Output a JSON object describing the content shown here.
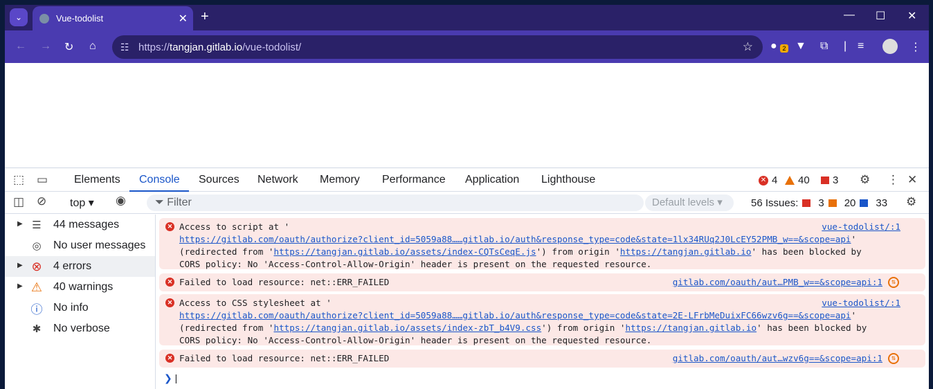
{
  "browser": {
    "tab_title": "Vue-todolist",
    "url_scheme": "https://",
    "url_host": "tangjan.gitlab.io",
    "url_path": "/vue-todolist/",
    "extension_badge": "2"
  },
  "devtools": {
    "tabs": [
      "Elements",
      "Console",
      "Sources",
      "Network",
      "Memory",
      "Performance",
      "Application",
      "Lighthouse"
    ],
    "active_tab": "Console",
    "counts": {
      "errors": "4",
      "warnings": "40",
      "issues": "3"
    },
    "context": "top",
    "filter_placeholder": "Filter",
    "levels": "Default levels",
    "issues_summary": {
      "label": "56 Issues:",
      "red": "3",
      "orange": "20",
      "blue": "33"
    }
  },
  "sidebar": {
    "items": [
      {
        "label": "44 messages",
        "icon": "list-icon"
      },
      {
        "label": "No user messages",
        "icon": "user-icon"
      },
      {
        "label": "4 errors",
        "icon": "error-icon"
      },
      {
        "label": "40 warnings",
        "icon": "warning-icon"
      },
      {
        "label": "No info",
        "icon": "info-icon"
      },
      {
        "label": "No verbose",
        "icon": "bug-icon"
      }
    ]
  },
  "console": {
    "messages": [
      {
        "l1": "Access to script at '",
        "url1": "https://gitlab.com/oauth/authorize?client_id=5059a88……gitlab.io/auth&response_type=code&state=1lx34RUq2J0LcEY52PMB_w==&scope=api",
        "l2_pre": "(redirected from '",
        "url2": "https://tangjan.gitlab.io/assets/index-CQTsCeqE.js",
        "l2_mid": "') from origin '",
        "url3": "https://tangjan.gitlab.io",
        "l2_post": "' has been blocked by",
        "l3": "CORS policy: No 'Access-Control-Allow-Origin' header is present on the requested resource.",
        "source": "vue-todolist/:1"
      },
      {
        "text": "Failed to load resource: net::ERR_FAILED",
        "source": "gitlab.com/oauth/aut…PMB_w==&scope=api:1"
      },
      {
        "l1": "Access to CSS stylesheet at '",
        "url1": "https://gitlab.com/oauth/authorize?client_id=5059a88……gitlab.io/auth&response_type=code&state=2E-LFrbMeDuixFC66wzv6g==&scope=api",
        "l2_pre": "(redirected from '",
        "url2": "https://tangjan.gitlab.io/assets/index-zbT_b4V9.css",
        "l2_mid": "') from origin '",
        "url3": "https://tangjan.gitlab.io",
        "l2_post": "' has been blocked by",
        "l3": "CORS policy: No 'Access-Control-Allow-Origin' header is present on the requested resource.",
        "source": "vue-todolist/:1"
      },
      {
        "text": "Failed to load resource: net::ERR_FAILED",
        "source": "gitlab.com/oauth/aut…wzv6g==&scope=api:1"
      }
    ]
  }
}
